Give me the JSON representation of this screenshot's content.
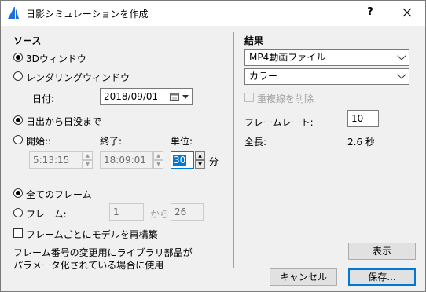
{
  "window": {
    "title": "日影シミュレーションを作成",
    "help": "?",
    "close": "✕"
  },
  "source": {
    "header": "ソース",
    "opt_3d": "3Dウィンドウ",
    "opt_render": "レンダリングウィンドウ",
    "date_label": "日付:",
    "date_value": "2018/09/01",
    "opt_sunrise": "日出から日没まで",
    "opt_start": "開始::",
    "end_label": "終了:",
    "unit_label": "単位:",
    "start_value": "5:13:15",
    "end_value": "18:09:01",
    "unit_value": "30",
    "unit_suffix": "分",
    "opt_all_frames": "全てのフレーム",
    "opt_frames": "フレーム:",
    "frame_from": "1",
    "frame_kara": "から",
    "frame_to": "26",
    "rebuild_label": "フレームごとにモデルを再構築",
    "note_line1": "フレーム番号の変更用にライブラリ部品が",
    "note_line2": "パラメータ化されている場合に使用"
  },
  "result": {
    "header": "結果",
    "format_value": "MP4動画ファイル",
    "color_value": "カラー",
    "remove_dup_label": "重複線を削除",
    "framerate_label": "フレームレート:",
    "framerate_value": "10",
    "length_label": "全長:",
    "length_value": "2.6 秒"
  },
  "buttons": {
    "show": "表示",
    "cancel": "キャンセル",
    "save": "保存..."
  }
}
